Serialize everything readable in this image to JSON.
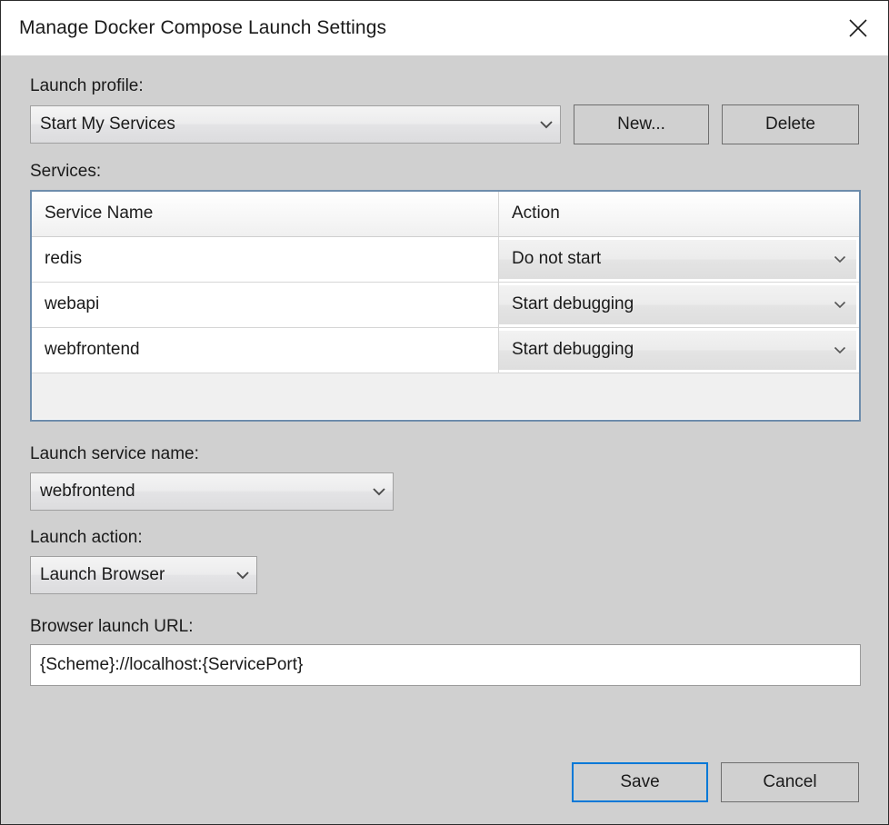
{
  "window": {
    "title": "Manage Docker Compose Launch Settings",
    "close_icon": "close-icon"
  },
  "launch_profile": {
    "label": "Launch profile:",
    "value": "Start My Services",
    "new_button": "New...",
    "delete_button": "Delete"
  },
  "services": {
    "label": "Services:",
    "columns": [
      "Service Name",
      "Action"
    ],
    "rows": [
      {
        "name": "redis",
        "action": "Do not start"
      },
      {
        "name": "webapi",
        "action": "Start debugging"
      },
      {
        "name": "webfrontend",
        "action": "Start debugging"
      }
    ]
  },
  "launch_service_name": {
    "label": "Launch service name:",
    "value": "webfrontend"
  },
  "launch_action": {
    "label": "Launch action:",
    "value": "Launch Browser"
  },
  "browser_launch_url": {
    "label": "Browser launch URL:",
    "value": "{Scheme}://localhost:{ServicePort}"
  },
  "footer": {
    "save_label": "Save",
    "cancel_label": "Cancel"
  },
  "colors": {
    "dialog_background": "#d0d0d0",
    "titlebar_background": "#ffffff",
    "grid_border": "#6d8cab",
    "focus_accent": "#0078d7",
    "text": "#1a1a1a"
  }
}
